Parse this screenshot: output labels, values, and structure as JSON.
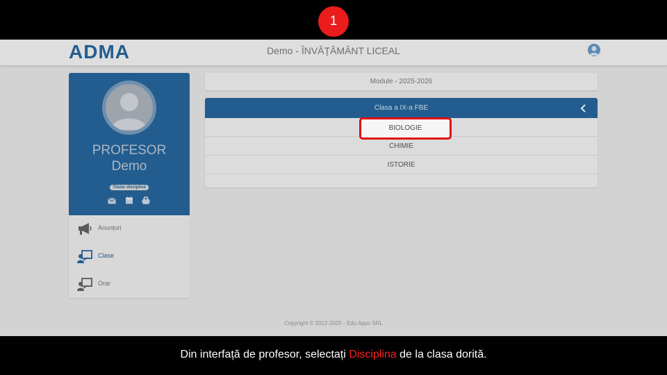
{
  "step": {
    "number": "1"
  },
  "header": {
    "logo": "ADMA",
    "title": "Demo - ÎNVĂȚĂMÂNT LICEAL"
  },
  "profile": {
    "role": "PROFESOR",
    "name": "Demo",
    "badge": "Titular disciplină"
  },
  "menu": {
    "items": [
      {
        "label": "Anunțuri",
        "icon": "megaphone-icon"
      },
      {
        "label": "Clase",
        "icon": "classroom-icon"
      },
      {
        "label": "Orar",
        "icon": "schedule-icon"
      }
    ]
  },
  "main": {
    "module_label": "Module - 2025-2026",
    "class_title": "Clasa a IX-a FBE",
    "subjects": [
      "BIOLOGIE",
      "CHIMIE",
      "ISTORIE"
    ]
  },
  "footer": {
    "text": "Copyright © 2012-2025 - Edu Apps SRL"
  },
  "caption": {
    "before": "Din interfață de profesor, selectați ",
    "highlight": "Disciplina",
    "after": " de la clasa dorită."
  },
  "colors": {
    "brand": "#235d8f",
    "highlight": "#e00c0c"
  }
}
